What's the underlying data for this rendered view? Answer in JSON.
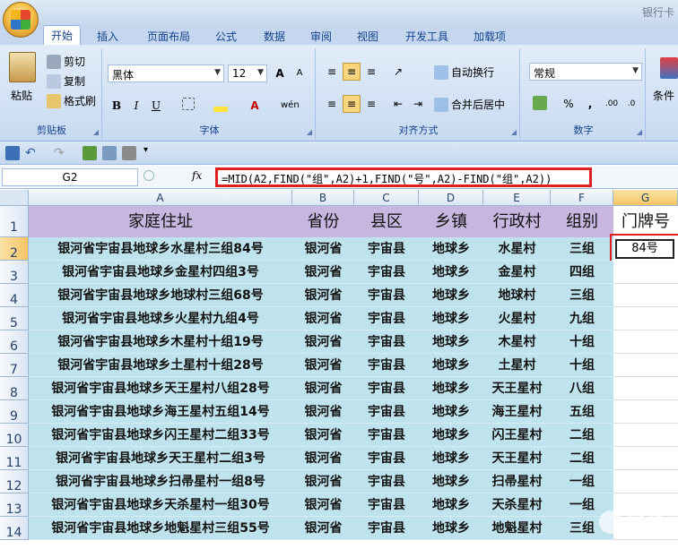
{
  "window": {
    "title": "银行卡"
  },
  "ribbon": {
    "tabs": [
      "开始",
      "插入",
      "页面布局",
      "公式",
      "数据",
      "审阅",
      "视图",
      "开发工具",
      "加载项"
    ],
    "clipboard": {
      "paste": "粘贴",
      "cut": "剪切",
      "copy": "复制",
      "format_painter": "格式刷",
      "label": "剪贴板"
    },
    "font": {
      "name": "黑体",
      "size": "12",
      "label": "字体",
      "bold": "B",
      "italic": "I",
      "underline": "U",
      "grow": "A",
      "shrink": "A"
    },
    "alignment": {
      "wrap": "自动换行",
      "merge": "合并后居中",
      "label": "对齐方式"
    },
    "number": {
      "format": "常规",
      "label": "数字",
      "percent": "%",
      "comma": ","
    },
    "styles": {
      "conditional": "条件"
    }
  },
  "formula_bar": {
    "name_box": "G2",
    "fx": "fx",
    "formula": "=MID(A2,FIND(\"组\",A2)+1,FIND(\"号\",A2)-FIND(\"组\",A2))"
  },
  "grid": {
    "columns": [
      "A",
      "B",
      "C",
      "D",
      "E",
      "F",
      "G"
    ],
    "headers": [
      "家庭住址",
      "省份",
      "县区",
      "乡镇",
      "行政村",
      "组别",
      "门牌号"
    ],
    "rows": [
      {
        "n": "2",
        "a": "银河省宇宙县地球乡水星村三组84号",
        "b": "银河省",
        "c": "宇宙县",
        "d": "地球乡",
        "e": "水星村",
        "f": "三组",
        "g": "84号"
      },
      {
        "n": "3",
        "a": "银河省宇宙县地球乡金星村四组3号",
        "b": "银河省",
        "c": "宇宙县",
        "d": "地球乡",
        "e": "金星村",
        "f": "四组",
        "g": ""
      },
      {
        "n": "4",
        "a": "银河省宇宙县地球乡地球村三组68号",
        "b": "银河省",
        "c": "宇宙县",
        "d": "地球乡",
        "e": "地球村",
        "f": "三组",
        "g": ""
      },
      {
        "n": "5",
        "a": "银河省宇宙县地球乡火星村九组4号",
        "b": "银河省",
        "c": "宇宙县",
        "d": "地球乡",
        "e": "火星村",
        "f": "九组",
        "g": ""
      },
      {
        "n": "6",
        "a": "银河省宇宙县地球乡木星村十组19号",
        "b": "银河省",
        "c": "宇宙县",
        "d": "地球乡",
        "e": "木星村",
        "f": "十组",
        "g": ""
      },
      {
        "n": "7",
        "a": "银河省宇宙县地球乡土星村十组28号",
        "b": "银河省",
        "c": "宇宙县",
        "d": "地球乡",
        "e": "土星村",
        "f": "十组",
        "g": ""
      },
      {
        "n": "8",
        "a": "银河省宇宙县地球乡天王星村八组28号",
        "b": "银河省",
        "c": "宇宙县",
        "d": "地球乡",
        "e": "天王星村",
        "f": "八组",
        "g": ""
      },
      {
        "n": "9",
        "a": "银河省宇宙县地球乡海王星村五组14号",
        "b": "银河省",
        "c": "宇宙县",
        "d": "地球乡",
        "e": "海王星村",
        "f": "五组",
        "g": ""
      },
      {
        "n": "10",
        "a": "银河省宇宙县地球乡闪王星村二组33号",
        "b": "银河省",
        "c": "宇宙县",
        "d": "地球乡",
        "e": "闪王星村",
        "f": "二组",
        "g": ""
      },
      {
        "n": "11",
        "a": "银河省宇宙县地球乡天王星村二组3号",
        "b": "银河省",
        "c": "宇宙县",
        "d": "地球乡",
        "e": "天王星村",
        "f": "二组",
        "g": ""
      },
      {
        "n": "12",
        "a": "银河省宇宙县地球乡扫帚星村一组8号",
        "b": "银河省",
        "c": "宇宙县",
        "d": "地球乡",
        "e": "扫帚星村",
        "f": "一组",
        "g": ""
      },
      {
        "n": "13",
        "a": "银河省宇宙县地球乡天杀星村一组30号",
        "b": "银河省",
        "c": "宇宙县",
        "d": "地球乡",
        "e": "天杀星村",
        "f": "一组",
        "g": ""
      },
      {
        "n": "14",
        "a": "银河省宇宙县地球乡地魁星村三组55号",
        "b": "银河省",
        "c": "宇宙县",
        "d": "地球乡",
        "e": "地魁星村",
        "f": "三组",
        "g": ""
      }
    ]
  },
  "watermark": "经验",
  "colors": {
    "header_fill": "#c7b6e0",
    "data_fill": "#bfe3ec",
    "highlight": "#e02020"
  }
}
